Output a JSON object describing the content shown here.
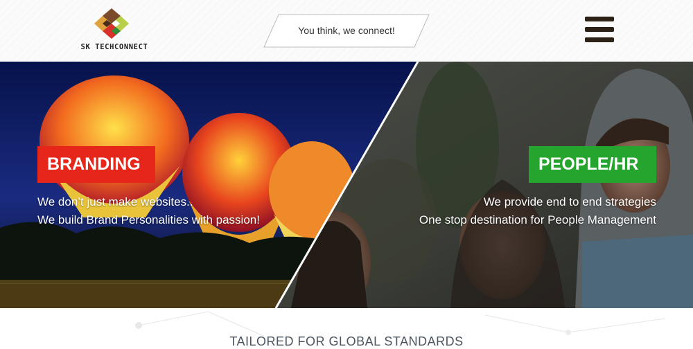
{
  "header": {
    "logo_text": "SK TECHCONNECT",
    "tagline": "You think, we connect!",
    "menu_icon": "hamburger-menu-icon"
  },
  "hero": {
    "branding": {
      "title": "BRANDING",
      "lines": [
        "We don’t just make websites..",
        "We build Brand Personalities with passion!"
      ]
    },
    "people": {
      "title": "PEOPLE/HR",
      "lines": [
        "We provide end to end strategies",
        "One stop destination for People Management"
      ]
    }
  },
  "section": {
    "title": "TAILORED FOR GLOBAL STANDARDS"
  },
  "colors": {
    "branding_red": "#e6261a",
    "people_green": "#26a52e",
    "menu_dark": "#2b2114",
    "night_sky": "#0a1a5c"
  }
}
